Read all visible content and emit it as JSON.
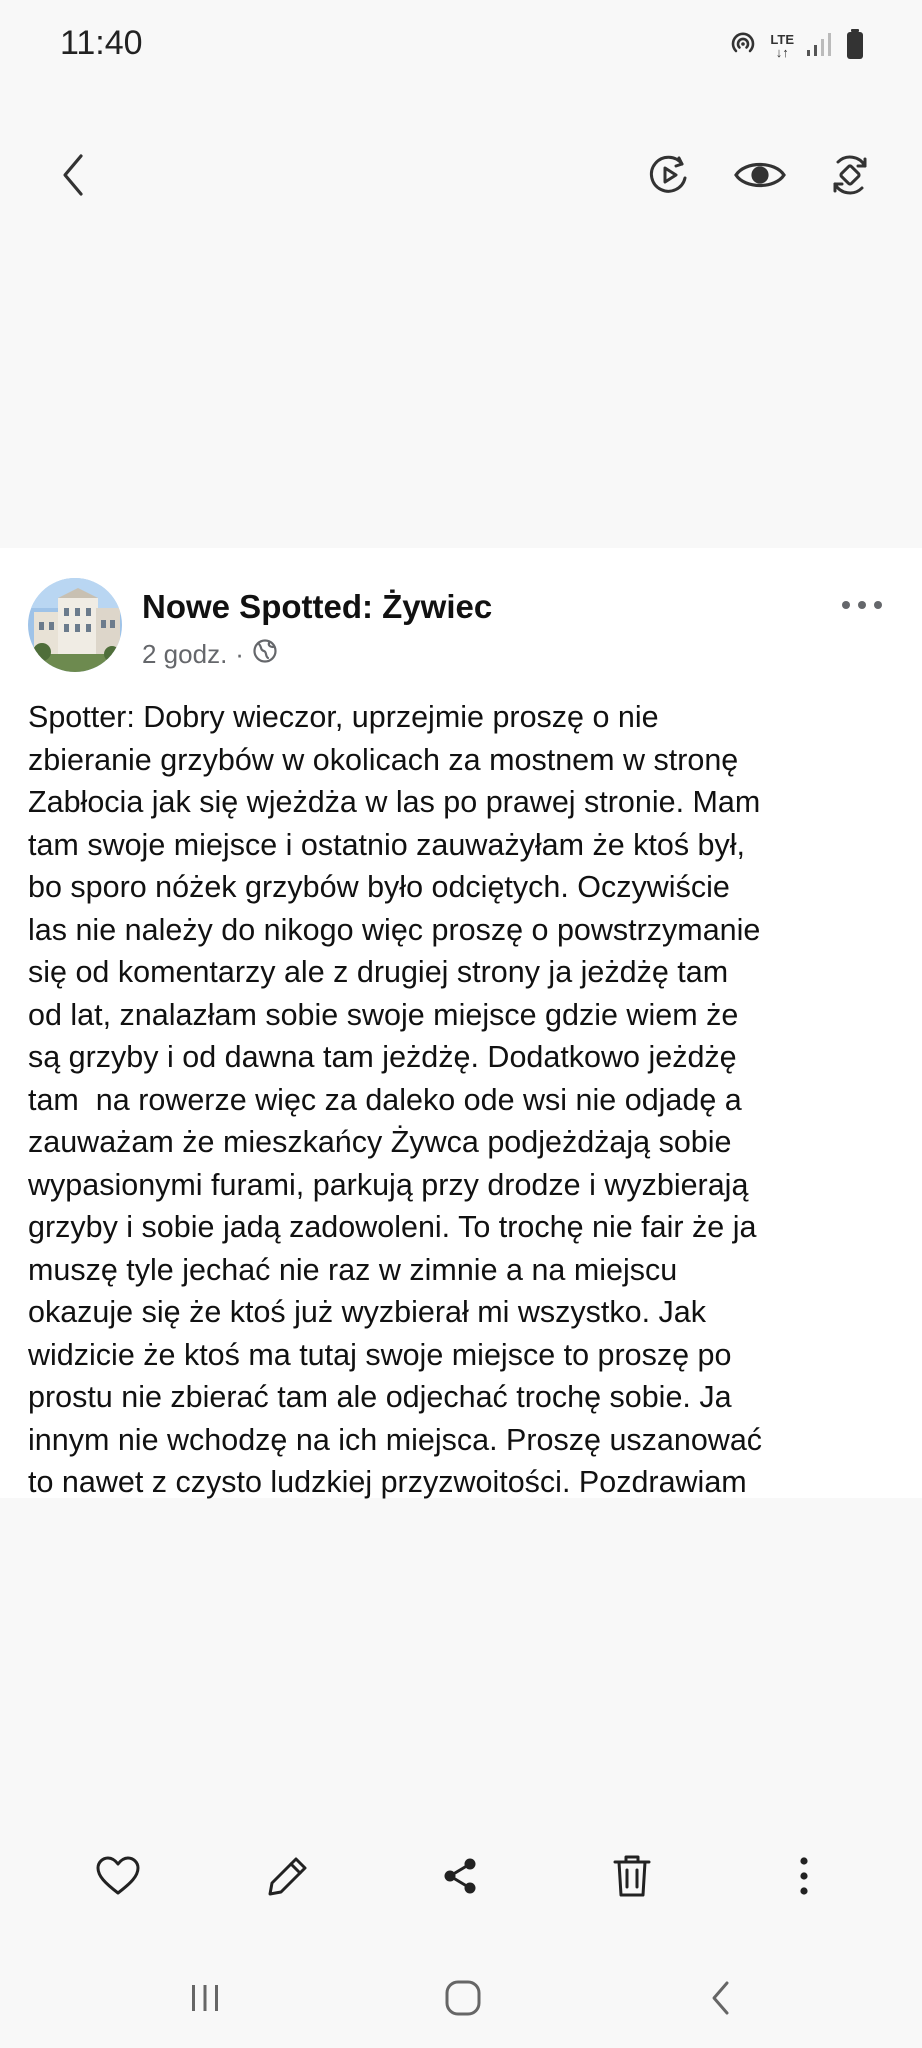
{
  "status_bar": {
    "time": "11:40",
    "network_label_top": "LTE",
    "network_label_bottom": "↓↑",
    "icons": [
      "hotspot-icon",
      "signal-icon",
      "battery-icon"
    ]
  },
  "viewer_toolbar": {
    "icons": [
      "back-arrow-icon",
      "video-remaster-icon",
      "eye-icon",
      "rotate-icon"
    ]
  },
  "post": {
    "page_name": "Nowe Spotted: Żywiec",
    "time_ago": "2 godz.",
    "separator": "·",
    "audience_icon": "globe-icon",
    "text_lines": [
      "Spotter: Dobry wieczor, uprzejmie proszę o nie",
      "zbieranie grzybów w okolicach za mostnem w stronę",
      "Zabłocia jak się wjeżdża w las po prawej stronie. Mam",
      "tam swoje miejsce i ostatnio zauważyłam że ktoś był,",
      "bo sporo nóżek grzybów było odciętych. Oczywiście",
      "las nie należy do nikogo więc proszę o powstrzymanie",
      "się od komentarzy ale z drugiej strony ja jeżdżę tam",
      "od lat, znalazłam sobie swoje miejsce gdzie wiem że",
      "są grzyby i od dawna tam jeżdżę. Dodatkowo jeżdżę",
      "tam  na rowerze więc za daleko ode wsi nie odjadę a",
      "zauważam że mieszkańcy Żywca podjeżdżają sobie",
      "wypasionymi furami, parkują przy drodze i wyzbierają",
      "grzyby i sobie jadą zadowoleni. To trochę nie fair że ja",
      "muszę tyle jechać nie raz w zimnie a na miejscu",
      "okazuje się że ktoś już wyzbierał mi wszystko. Jak",
      "widzicie że ktoś ma tutaj swoje miejsce to proszę po",
      "prostu nie zbierać tam ale odjechać trochę sobie. Ja",
      "innym nie wchodzę na ich miejsca. Proszę uszanować",
      "to nawet z czysto ludzkiej przyzwoitości. Pozdrawiam"
    ]
  },
  "bottom_actions": {
    "icons": [
      "heart-icon",
      "edit-pencil-icon",
      "share-icon",
      "trash-icon",
      "more-vertical-icon"
    ]
  },
  "nav_bar": {
    "icons": [
      "recent-apps-icon",
      "home-icon",
      "back-icon"
    ]
  },
  "colors": {
    "background": "#f8f8f8",
    "post_background": "#ffffff",
    "text": "#111111",
    "meta_text": "#65676b"
  }
}
